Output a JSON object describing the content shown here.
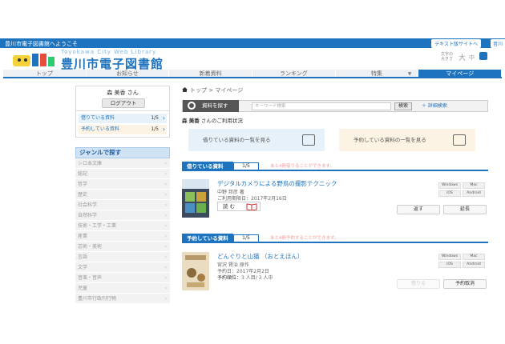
{
  "topbar": {
    "welcome": "豊川市電子図書館へようこそ",
    "text_only_label": "テキスト版サイトへ",
    "lang_label": "音川"
  },
  "logo": {
    "sub": "Toyokawa City Web Library",
    "main": "豊川市電子図書館"
  },
  "fontsize": {
    "label": "文字の大きさ",
    "sizes": [
      "大",
      "中"
    ]
  },
  "nav": {
    "items": [
      "トップ",
      "お知らせ",
      "新着資料",
      "ランキング",
      "特集",
      "マイページ"
    ],
    "active_index": 5
  },
  "sidebar": {
    "user_name": "森 美香 さん",
    "logout_label": "ログアウト",
    "lending_label": "借りている資料",
    "lending_count": "1/5",
    "reserve_label": "予約している資料",
    "reserve_count": "1/5",
    "genre_heading": "ジャンルで探す",
    "genres": [
      "シロ本文庫",
      "総記",
      "哲学",
      "歴史",
      "社会科学",
      "自然科学",
      "技術・工学・工業",
      "産業",
      "芸術・美術",
      "言語",
      "文学",
      "音楽・音声",
      "児童",
      "豊川市行政刊行物"
    ]
  },
  "main": {
    "breadcrumb_home": "トップ",
    "breadcrumb_sep": " > ",
    "breadcrumb_current": "マイページ",
    "search_label": "資料を探す",
    "search_placeholder": "キーワード検索",
    "search_button": "検索",
    "advanced_search": "＋ 詳細検索",
    "status_name": "森 美香",
    "status_text": " さんのご利用状況",
    "lend_list_button": "借りている資料の一覧を見る",
    "reserve_list_button": "予約している資料の一覧を見る"
  },
  "lending": {
    "heading": "借りている資料",
    "count": "1/5",
    "note": "あと4冊借りることができます。",
    "title": "デジタルカメラによる野鳥の撮影テクニック",
    "author": "中野 邦彦 著",
    "date_label": "ご利用期限日：",
    "date_value": "2017年2月16日",
    "read_label": "読 む",
    "formats": [
      "Windows",
      "Mac",
      "iOS",
      "Android"
    ],
    "return_label": "返す",
    "extend_label": "延長"
  },
  "reserve": {
    "heading": "予約している資料",
    "count": "1/5",
    "note": "あと4冊予約することができます。",
    "title": "どんぐりと山猫 （おとえほん）",
    "author": "宮沢 賢治 原作",
    "date_label": "予約日：",
    "date_value": "2017年2月2日",
    "rank_label": "予約順位：",
    "rank_value": "3 人目/ 3 人中",
    "formats": [
      "Windows",
      "Mac",
      "iOS",
      "Android"
    ],
    "borrow_label": "借りる",
    "cancel_label": "予約取消"
  },
  "colors": {
    "accent": "#1e73be",
    "note": "#f09999",
    "lend_bg": "#e6f1fa",
    "reserve_bg": "#fdf3e4"
  }
}
